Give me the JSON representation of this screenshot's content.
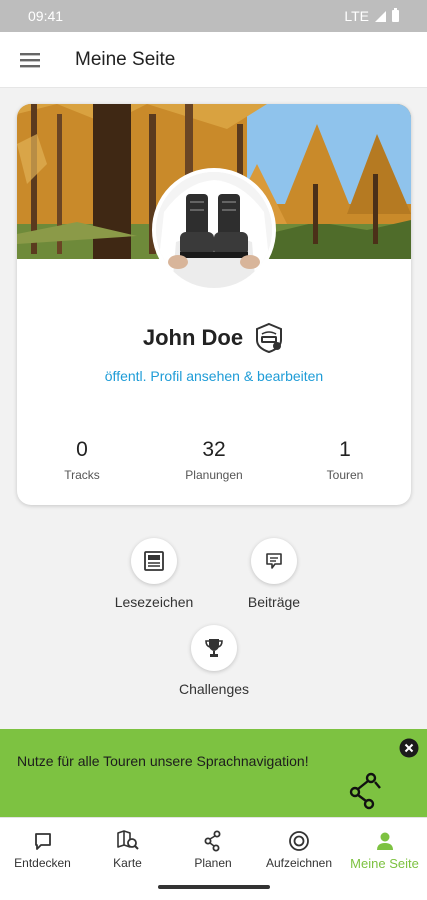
{
  "status_bar": {
    "time": "09:41",
    "network": "LTE"
  },
  "app_bar": {
    "title": "Meine Seite"
  },
  "profile": {
    "name": "John Doe",
    "profile_link": "öffentl. Profil ansehen & bearbeiten",
    "badge_icon": "pro-badge-icon",
    "stats": [
      {
        "value": "0",
        "label": "Tracks"
      },
      {
        "value": "32",
        "label": "Planungen"
      },
      {
        "value": "1",
        "label": "Touren"
      }
    ]
  },
  "shortcuts": [
    {
      "label": "Lesezeichen",
      "icon": "bookmark-icon"
    },
    {
      "label": "Beiträge",
      "icon": "comment-icon"
    },
    {
      "label": "Challenges",
      "icon": "trophy-icon"
    }
  ],
  "promo": {
    "text": "Nutze für alle Touren unsere Sprachnavigation!",
    "icon": "route-navigation-icon"
  },
  "bottom_nav": [
    {
      "label": "Entdecken",
      "icon": "chat-bubble-icon",
      "active": false
    },
    {
      "label": "Karte",
      "icon": "map-search-icon",
      "active": false
    },
    {
      "label": "Planen",
      "icon": "route-plan-icon",
      "active": false
    },
    {
      "label": "Aufzeichnen",
      "icon": "record-icon",
      "active": false
    },
    {
      "label": "Meine Seite",
      "icon": "person-icon",
      "active": true
    }
  ],
  "colors": {
    "accent": "#7dc241",
    "link": "#1e9cd7",
    "status_bar": "#bdbdbd"
  }
}
